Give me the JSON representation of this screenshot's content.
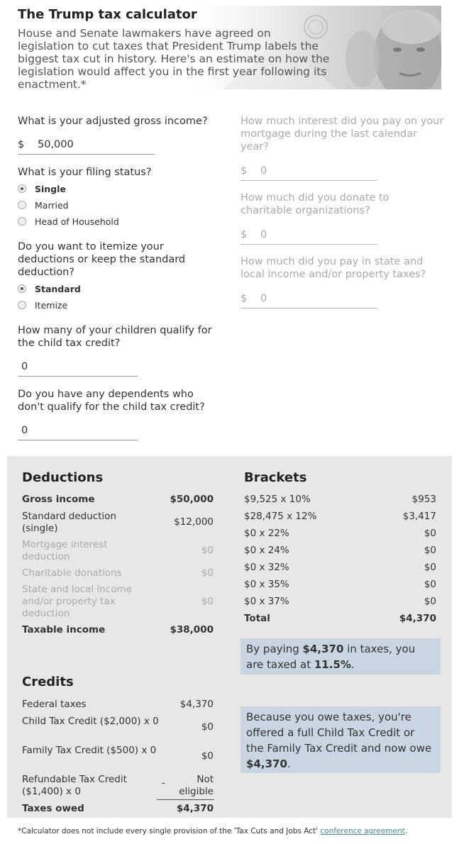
{
  "header": {
    "title": "The Trump tax calculator",
    "intro": "House and Senate lawmakers have agreed on legislation to cut taxes that President Trump labels the biggest tax cut in history. Here's an estimate on how the legislation would affect you in the first year following its enactment.*"
  },
  "form": {
    "currency": "$",
    "income": {
      "question": "What is your adjusted gross income?",
      "value": "50,000"
    },
    "filing": {
      "question": "What is your filing status?",
      "options": [
        "Single",
        "Married",
        "Head of Household"
      ],
      "selected": "Single"
    },
    "deduction": {
      "question": "Do you want to itemize your deductions or keep the standard deduction?",
      "options": [
        "Standard",
        "Itemize"
      ],
      "selected": "Standard"
    },
    "children": {
      "question": "How many of your children qualify for the child tax credit?",
      "value": "0"
    },
    "dependents": {
      "question": "Do you have any dependents who don't qualify for the child tax credit?",
      "value": "0"
    },
    "mortgage": {
      "question": "How much interest did you pay on your mortgage during the last calendar year?",
      "value": "0"
    },
    "charity": {
      "question": "How much did you donate to charitable organizations?",
      "value": "0"
    },
    "state_tax": {
      "question": "How much did you pay in state and local income and/or property taxes?",
      "value": "0"
    }
  },
  "deductions": {
    "title": "Deductions",
    "rows": [
      {
        "label": "Gross income",
        "amount": "$50,000"
      },
      {
        "label": "Standard deduction (single)",
        "amount": "$12,000"
      },
      {
        "label": "Mortgage interest deduction",
        "amount": "$0"
      },
      {
        "label": "Charitable donations",
        "amount": "$0"
      },
      {
        "label": "State and local income and/or property tax deduction",
        "amount": "$0"
      },
      {
        "label": "Taxable income",
        "amount": "$38,000"
      }
    ]
  },
  "brackets": {
    "title": "Brackets",
    "rows": [
      {
        "label": "$9,525 x 10%",
        "amount": "$953"
      },
      {
        "label": "$28,475 x 12%",
        "amount": "$3,417"
      },
      {
        "label": "$0 x 22%",
        "amount": "$0"
      },
      {
        "label": "$0 x 24%",
        "amount": "$0"
      },
      {
        "label": "$0 x 32%",
        "amount": "$0"
      },
      {
        "label": "$0 x 35%",
        "amount": "$0"
      },
      {
        "label": "$0 x 37%",
        "amount": "$0"
      },
      {
        "label": "Total",
        "amount": "$4,370"
      }
    ],
    "summary": {
      "pre": "By paying ",
      "amount": "$4,370",
      "mid": " in taxes, you are taxed at ",
      "rate": "11.5%",
      "post": "."
    }
  },
  "credits": {
    "title": "Credits",
    "rows": [
      {
        "label": "Federal taxes",
        "amount": "$4,370"
      },
      {
        "label": "Child Tax Credit ($2,000) x 0",
        "amount": "$0"
      },
      {
        "label": "Family Tax Credit ($500) x 0",
        "amount": "$0"
      },
      {
        "label": "Refundable Tax Credit ($1,400) x 0",
        "amount": "Not eligible",
        "sign": "-"
      },
      {
        "label": "Taxes owed",
        "amount": "$4,370"
      }
    ],
    "summary": {
      "pre": "Because you owe taxes, you're offered a full Child Tax Credit or the Family Tax Credit and now owe ",
      "amount": "$4,370",
      "post": "."
    }
  },
  "footnote": {
    "text": "*Calculator does not include every single provision of the 'Tax Cuts and Jobs Act' ",
    "link": "conference agreement",
    "end": "."
  }
}
